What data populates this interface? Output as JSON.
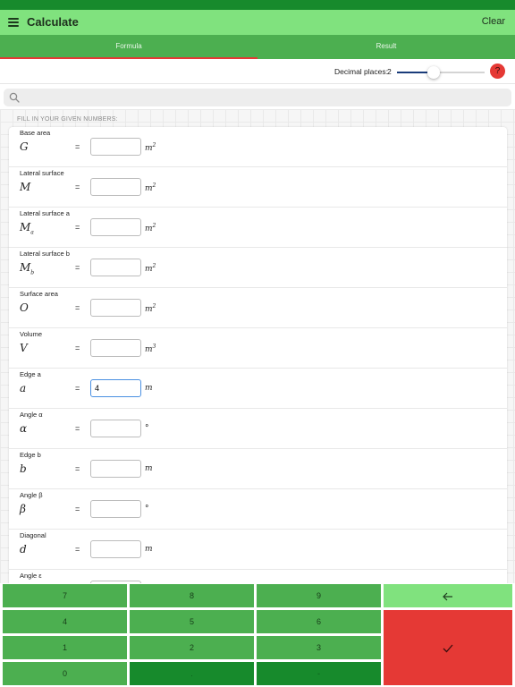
{
  "app": {
    "title": "Calculate",
    "clear_label": "Clear"
  },
  "tabs": [
    {
      "label": "Formula",
      "active": true
    },
    {
      "label": "Result",
      "active": false
    }
  ],
  "decimal": {
    "label": "Decimal places:",
    "value": "2",
    "slider_fraction": 0.42,
    "help_label": "?"
  },
  "search": {
    "placeholder": ""
  },
  "section": {
    "title": "FILL IN YOUR GIVEN NUMBERS:"
  },
  "fields": [
    {
      "label": "Base area",
      "symbol": "G",
      "sub": "",
      "unit": "m",
      "unit_sup": "2",
      "value": ""
    },
    {
      "label": "Lateral surface",
      "symbol": "M",
      "sub": "",
      "unit": "m",
      "unit_sup": "2",
      "value": ""
    },
    {
      "label": "Lateral surface a",
      "symbol": "M",
      "sub": "a",
      "unit": "m",
      "unit_sup": "2",
      "value": ""
    },
    {
      "label": "Lateral surface b",
      "symbol": "M",
      "sub": "b",
      "unit": "m",
      "unit_sup": "2",
      "value": ""
    },
    {
      "label": "Surface area",
      "symbol": "O",
      "sub": "",
      "unit": "m",
      "unit_sup": "2",
      "value": ""
    },
    {
      "label": "Volume",
      "symbol": "V",
      "sub": "",
      "unit": "m",
      "unit_sup": "3",
      "value": ""
    },
    {
      "label": "Edge a",
      "symbol": "a",
      "sub": "",
      "unit": "m",
      "unit_sup": "",
      "value": "4"
    },
    {
      "label": "Angle α",
      "symbol": "α",
      "sub": "",
      "unit": "°",
      "unit_sup": "",
      "value": ""
    },
    {
      "label": "Edge b",
      "symbol": "b",
      "sub": "",
      "unit": "m",
      "unit_sup": "",
      "value": ""
    },
    {
      "label": "Angle β",
      "symbol": "β",
      "sub": "",
      "unit": "°",
      "unit_sup": "",
      "value": ""
    },
    {
      "label": "Diagonal",
      "symbol": "d",
      "sub": "",
      "unit": "m",
      "unit_sup": "",
      "value": ""
    },
    {
      "label": "Angle ε",
      "symbol": "ε",
      "sub": "",
      "unit": "°",
      "unit_sup": "",
      "value": ""
    }
  ],
  "equals": "=",
  "keypad": {
    "k7": "7",
    "k8": "8",
    "k9": "9",
    "k4": "4",
    "k5": "5",
    "k6": "6",
    "k1": "1",
    "k2": "2",
    "k3": "3",
    "k0": "0",
    "kdot": ".",
    "kminus": "-",
    "back_icon": "backspace-arrow-icon",
    "confirm_icon": "checkmark-icon"
  },
  "colors": {
    "status_bar": "#178a2c",
    "header": "#80e27e",
    "tab_bar": "#4caf50",
    "active_tab_underline": "#e53935",
    "key_green": "#4caf50",
    "key_dark": "#178a2c",
    "key_red": "#e53935"
  }
}
